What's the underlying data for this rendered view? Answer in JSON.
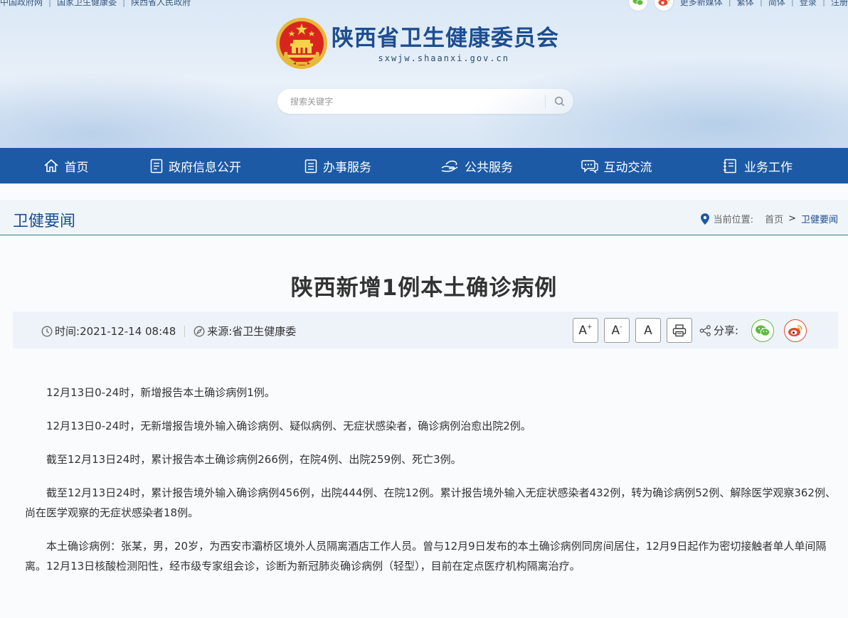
{
  "top_links": [
    "中国政府网",
    "国家卫生健康委",
    "陕西省人民政府"
  ],
  "top_right": {
    "more_media": "更多新媒体",
    "traditional": "繁体",
    "simplified": "简体",
    "login": "登录",
    "register": "注册"
  },
  "site": {
    "title_cn": "陕西省卫生健康委员会",
    "domain": "sxwjw.shaanxi.gov.cn"
  },
  "search": {
    "placeholder": "搜索关键字"
  },
  "nav": [
    {
      "label": "首页",
      "icon": "home-icon"
    },
    {
      "label": "政府信息公开",
      "icon": "document-list-icon"
    },
    {
      "label": "办事服务",
      "icon": "clipboard-icon"
    },
    {
      "label": "公共服务",
      "icon": "hands-icon"
    },
    {
      "label": "互动交流",
      "icon": "chat-icon"
    },
    {
      "label": "业务工作",
      "icon": "notebook-icon"
    }
  ],
  "column": {
    "title": "卫健要闻",
    "location_label": "当前位置:",
    "crumb_home": "首页",
    "crumb_sep": ">",
    "crumb_current": "卫健要闻"
  },
  "article": {
    "title": "陕西新增1例本土确诊病例",
    "time_label": "时间:",
    "time_value": "2021-12-14 08:48",
    "source_label": "来源:",
    "source_value": "省卫生健康委",
    "font_larger": "A",
    "font_larger_sup": "+",
    "font_smaller": "A",
    "font_smaller_sup": "-",
    "font_default": "A",
    "share_label": "分享:",
    "paragraphs": [
      "12月13日0-24时，新增报告本土确诊病例1例。",
      "12月13日0-24时，无新增报告境外输入确诊病例、疑似病例、无症状感染者，确诊病例治愈出院2例。",
      "截至12月13日24时，累计报告本土确诊病例266例，在院4例、出院259例、死亡3例。",
      "截至12月13日24时，累计报告境外输入确诊病例456例，出院444例、在院12例。累计报告境外输入无症状感染者432例，转为确诊病例52例、解除医学观察362例、尚在医学观察的无症状感染者18例。",
      "本土确诊病例：张某，男，20岁，为西安市灞桥区境外人员隔离酒店工作人员。曾与12月9日发布的本土确诊病例同房间居住，12月9日起作为密切接触者单人单间隔离。12月13日核酸检测阳性，经市级专家组会诊，诊断为新冠肺炎确诊病例（轻型），目前在定点医疗机构隔离治疗。"
    ]
  },
  "colors": {
    "nav_bg": "#1c5aa5",
    "title_blue": "#1d4e8f",
    "wechat_green": "#5dbb3e",
    "weibo_red": "#e6492d"
  }
}
